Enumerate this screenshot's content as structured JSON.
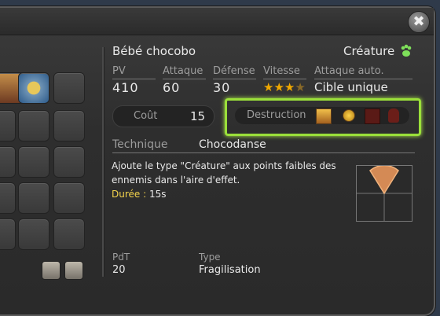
{
  "window": {
    "close_label": "✖"
  },
  "card": {
    "name": "Bébé chocobo",
    "category": "Créature",
    "stats": {
      "pv_label": "PV",
      "pv_value": "410",
      "attack_label": "Attaque",
      "attack_value": "60",
      "defense_label": "Défense",
      "defense_value": "30",
      "speed_label": "Vitesse",
      "speed_stars": "★★★",
      "speed_stars_empty": "★",
      "auto_attack_label": "Attaque auto.",
      "auto_attack_value": "Cible unique"
    },
    "cost_label": "Coût",
    "cost_value": "15",
    "destruction_label": "Destruction",
    "technique_label": "Technique",
    "technique_name": "Chocodanse",
    "description": "Ajoute le type \"Créature\" aux points faibles des ennemis dans l'aire d'effet.",
    "duration_label": "Durée :",
    "duration_value": "15s",
    "pdt_label": "PdT",
    "pdt_value": "20",
    "type_label": "Type",
    "type_value": "Fragilisation"
  },
  "colors": {
    "accent_green": "#9be03a",
    "duration_yellow": "#f2d24b",
    "star_gold": "#f0a800"
  }
}
